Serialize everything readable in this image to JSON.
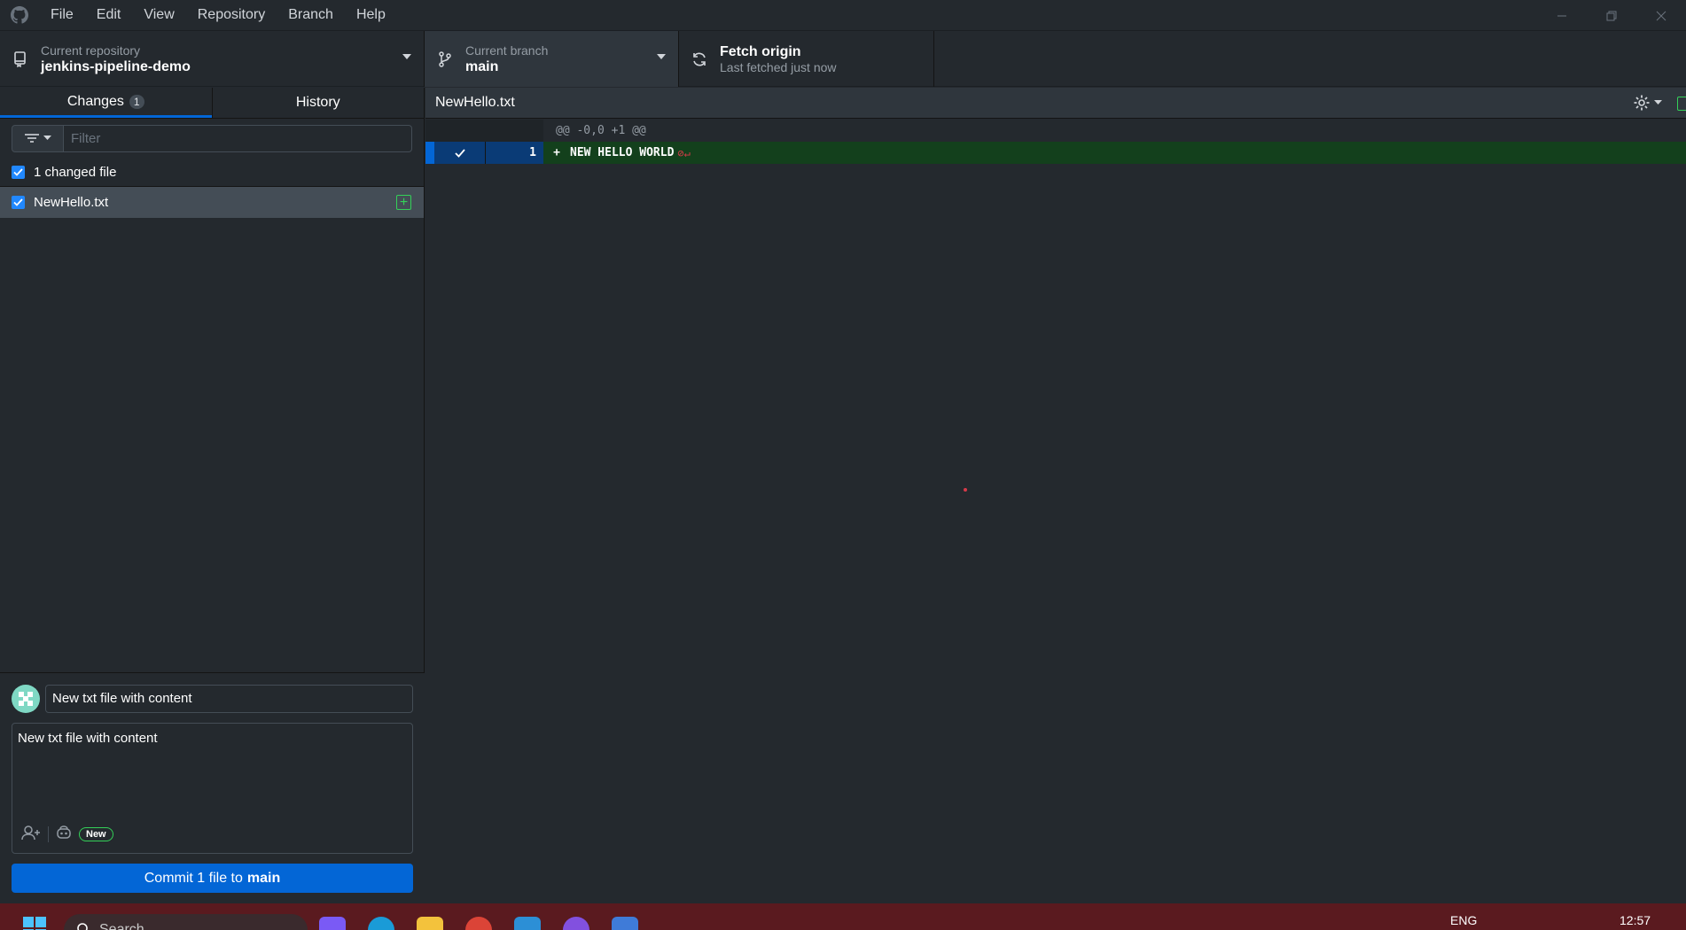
{
  "menu": {
    "items": [
      "File",
      "Edit",
      "View",
      "Repository",
      "Branch",
      "Help"
    ]
  },
  "toolbar": {
    "repo": {
      "label": "Current repository",
      "value": "jenkins-pipeline-demo"
    },
    "branch": {
      "label": "Current branch",
      "value": "main"
    },
    "fetch": {
      "title": "Fetch origin",
      "subtitle": "Last fetched just now"
    }
  },
  "sidebar": {
    "tabs": [
      {
        "label": "Changes",
        "count": "1"
      },
      {
        "label": "History"
      }
    ],
    "filter": {
      "placeholder": "Filter"
    },
    "changed_summary": "1 changed file",
    "files": [
      {
        "name": "NewHello.txt",
        "status": "added"
      }
    ]
  },
  "commit": {
    "summary": "New txt file with content",
    "description": "New txt file with content",
    "new_badge": "New",
    "button_prefix": "Commit 1 file to",
    "button_branch": "main"
  },
  "diff": {
    "filename": "NewHello.txt",
    "hunk_header": "@@ -0,0 +1 @@",
    "lines": [
      {
        "number": "1",
        "marker": "+",
        "text": "NEW HELLO WORLD"
      }
    ]
  },
  "taskbar": {
    "search_placeholder": "Search",
    "language": "ENG",
    "time": "12:57"
  },
  "colors": {
    "accent": "#0366d6",
    "added": "#34d058",
    "added_bg": "#13401c",
    "background": "#24292e",
    "taskbar": "#5a1a1f"
  }
}
